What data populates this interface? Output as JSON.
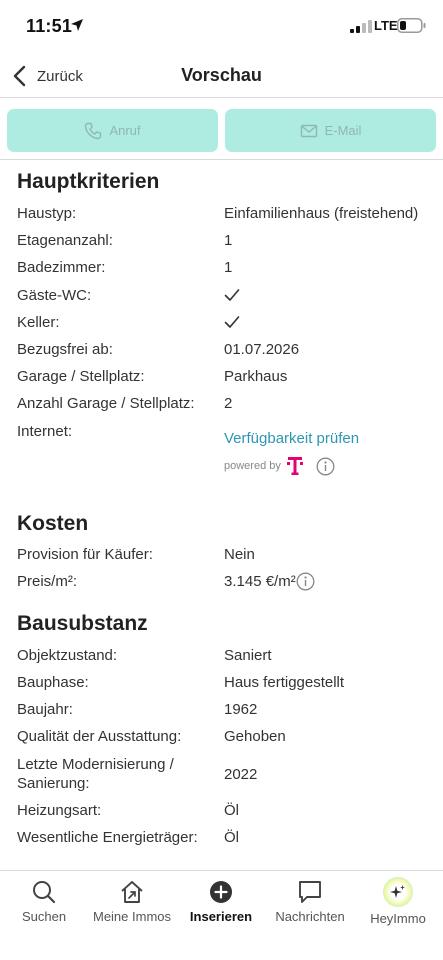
{
  "status": {
    "time": "11:51",
    "network": "LTE"
  },
  "nav": {
    "back_label": "Zurück",
    "title": "Vorschau"
  },
  "actions": {
    "call_label": "Anruf",
    "email_label": "E-Mail"
  },
  "sections": {
    "main": {
      "title": "Hauptkriterien",
      "rows": [
        {
          "label": "Haustyp:",
          "value": "Einfamilienhaus (freistehend)"
        },
        {
          "label": "Etagenanzahl:",
          "value": "1"
        },
        {
          "label": "Badezimmer:",
          "value": "1"
        },
        {
          "label": "Gäste-WC:",
          "value": "check"
        },
        {
          "label": "Keller:",
          "value": "check"
        },
        {
          "label": "Bezugsfrei ab:",
          "value": "01.07.2026"
        },
        {
          "label": "Garage / Stellplatz:",
          "value": "Parkhaus"
        },
        {
          "label": "Anzahl Garage / Stellplatz:",
          "value": "2"
        },
        {
          "label": "Internet:",
          "value": "Verfügbarkeit prüfen"
        }
      ],
      "powered_by": "powered by"
    },
    "costs": {
      "title": "Kosten",
      "rows": [
        {
          "label": "Provision für Käufer:",
          "value": "Nein"
        },
        {
          "label": "Preis/m²:",
          "value": "3.145 €/m²"
        }
      ]
    },
    "building": {
      "title": "Bausubstanz",
      "rows": [
        {
          "label": "Objektzustand:",
          "value": "Saniert"
        },
        {
          "label": "Bauphase:",
          "value": "Haus fertiggestellt"
        },
        {
          "label": "Baujahr:",
          "value": "1962"
        },
        {
          "label": "Qualität der Ausstattung:",
          "value": "Gehoben"
        },
        {
          "label_line1": "Letzte Modernisierung /",
          "label_line2": "Sanierung:",
          "value": "2022"
        },
        {
          "label": "Heizungsart:",
          "value": "Öl"
        },
        {
          "label": "Wesentliche Energieträger:",
          "value": "Öl"
        }
      ]
    }
  },
  "tabbar": {
    "items": [
      {
        "label": "Suchen",
        "icon": "search-icon"
      },
      {
        "label": "Meine Immos",
        "icon": "home-icon"
      },
      {
        "label": "Inserieren",
        "icon": "plus-circle-icon",
        "active": true
      },
      {
        "label": "Nachrichten",
        "icon": "chat-icon"
      },
      {
        "label": "HeyImmo",
        "icon": "sparkle-icon"
      }
    ]
  },
  "colors": {
    "accent": "#2c96b4",
    "button_bg": "#aeebe0",
    "telekom": "#e20074"
  }
}
